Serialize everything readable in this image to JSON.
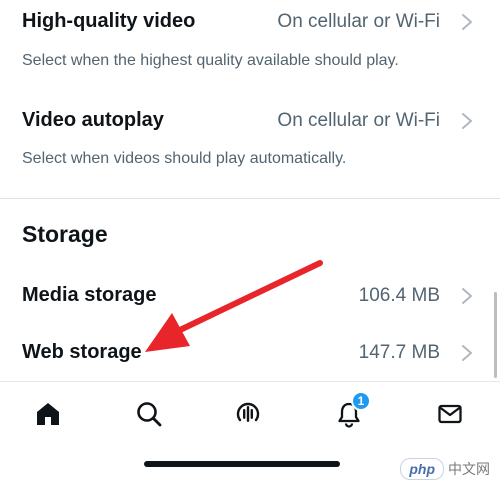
{
  "settings": {
    "hq_video": {
      "label": "High-quality video",
      "value": "On cellular or Wi-Fi",
      "description": "Select when the highest quality available should play."
    },
    "autoplay": {
      "label": "Video autoplay",
      "value": "On cellular or Wi-Fi",
      "description": "Select when videos should play automatically."
    }
  },
  "storage": {
    "title": "Storage",
    "media": {
      "label": "Media storage",
      "value": "106.4 MB"
    },
    "web": {
      "label": "Web storage",
      "value": "147.7 MB"
    }
  },
  "tabbar": {
    "icons": [
      "home-icon",
      "search-icon",
      "spaces-icon",
      "notifications-icon",
      "messages-icon"
    ],
    "notifications_badge": "1"
  },
  "watermark": {
    "logo": "php",
    "text": "中文网"
  },
  "colors": {
    "text_primary": "#0f1419",
    "text_secondary": "#536471",
    "accent": "#1d9bf0",
    "arrow": "#e8252b"
  }
}
